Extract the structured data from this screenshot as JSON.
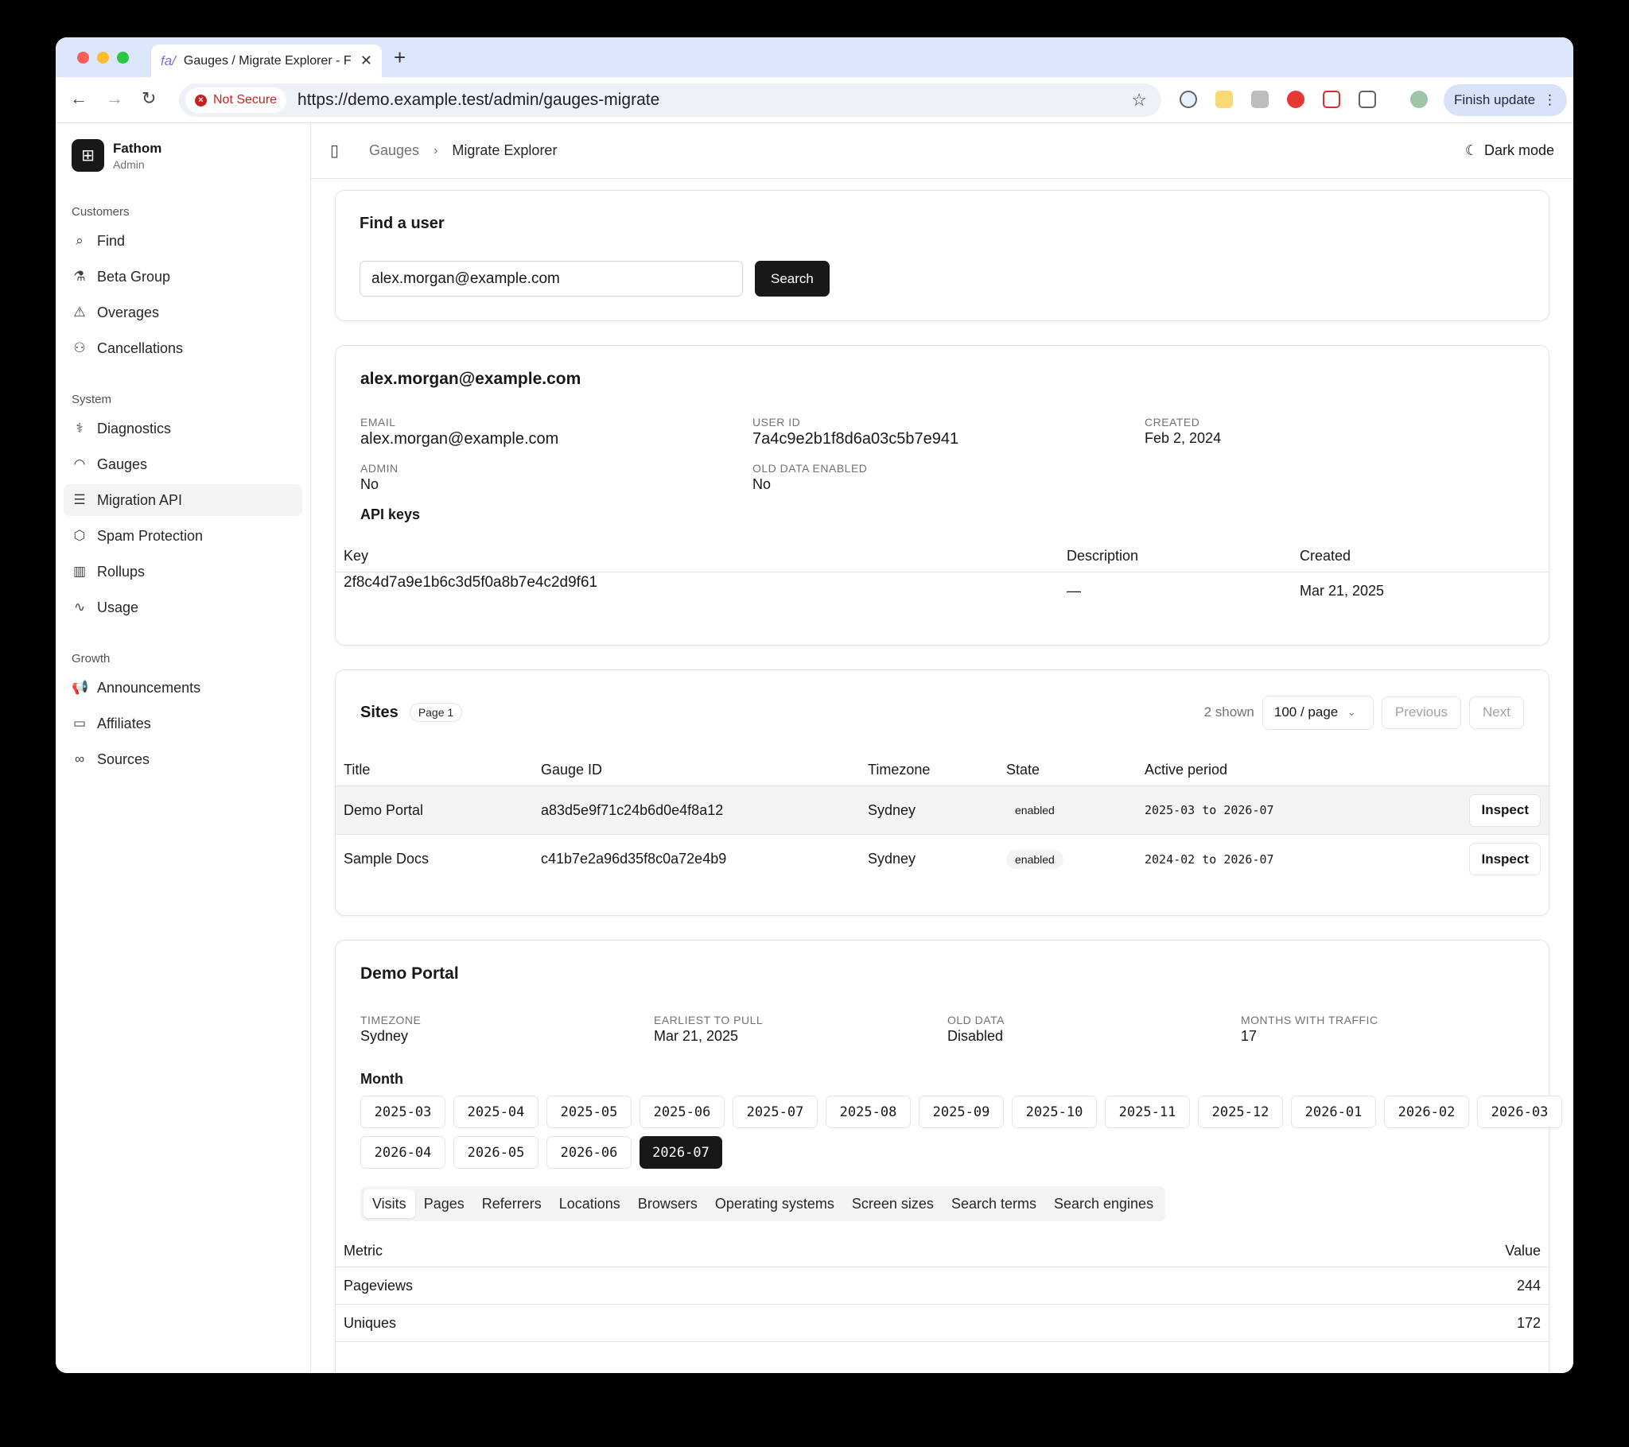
{
  "browser": {
    "tab_title": "Gauges / Migrate Explorer - F",
    "tab_favicon": "fa/",
    "security_label": "Not Secure",
    "url": "https://demo.example.test/admin/gauges-migrate",
    "finish_update": "Finish update"
  },
  "brand": {
    "name": "Fathom",
    "subtitle": "Admin"
  },
  "sidebar": {
    "groups": [
      {
        "label": "Customers",
        "items": [
          {
            "label": "Find",
            "icon": "search-icon"
          },
          {
            "label": "Beta Group",
            "icon": "flask-icon"
          },
          {
            "label": "Overages",
            "icon": "warning-icon"
          },
          {
            "label": "Cancellations",
            "icon": "user-minus-icon"
          }
        ]
      },
      {
        "label": "System",
        "items": [
          {
            "label": "Diagnostics",
            "icon": "stethoscope-icon"
          },
          {
            "label": "Gauges",
            "icon": "gauge-icon"
          },
          {
            "label": "Migration API",
            "icon": "database-icon",
            "active": true
          },
          {
            "label": "Spam Protection",
            "icon": "shield-icon"
          },
          {
            "label": "Rollups",
            "icon": "bar-chart-icon"
          },
          {
            "label": "Usage",
            "icon": "activity-icon"
          }
        ]
      },
      {
        "label": "Growth",
        "items": [
          {
            "label": "Announcements",
            "icon": "megaphone-icon"
          },
          {
            "label": "Affiliates",
            "icon": "banknote-icon"
          },
          {
            "label": "Sources",
            "icon": "link-icon"
          }
        ]
      }
    ]
  },
  "topbar": {
    "crumb_parent": "Gauges",
    "crumb_current": "Migrate Explorer",
    "dark_mode": "Dark mode"
  },
  "find": {
    "title": "Find a user",
    "input_value": "alex.morgan@example.com",
    "search_button": "Search"
  },
  "user": {
    "heading": "alex.morgan@example.com",
    "email_label": "EMAIL",
    "email": "alex.morgan@example.com",
    "user_id_label": "USER ID",
    "user_id": "7a4c9e2b1f8d6a03c5b7e941",
    "created_label": "CREATED",
    "created": "Feb 2, 2024",
    "admin_label": "ADMIN",
    "admin": "No",
    "old_data_label": "OLD DATA ENABLED",
    "old_data": "No",
    "api_keys_title": "API keys",
    "keys_columns": [
      "Key",
      "Description",
      "Created"
    ],
    "keys": [
      {
        "key": "2f8c4d7a9e1b6c3d5f0a8b7e4c2d9f61",
        "description": "—",
        "created": "Mar 21, 2025"
      }
    ]
  },
  "sites": {
    "title": "Sites",
    "page_badge": "Page 1",
    "shown": "2 shown",
    "per_page": "100 / page",
    "previous": "Previous",
    "next": "Next",
    "columns": [
      "Title",
      "Gauge ID",
      "Timezone",
      "State",
      "Active period"
    ],
    "rows": [
      {
        "title": "Demo Portal",
        "gauge_id": "a83d5e9f71c24b6d0e4f8a12",
        "timezone": "Sydney",
        "state": "enabled",
        "period": "2025-03 to 2026-07",
        "action": "Inspect"
      },
      {
        "title": "Sample Docs",
        "gauge_id": "c41b7e2a96d35f8c0a72e4b9",
        "timezone": "Sydney",
        "state": "enabled",
        "period": "2024-02 to 2026-07",
        "action": "Inspect"
      }
    ]
  },
  "detail": {
    "title": "Demo Portal",
    "timezone_label": "TIMEZONE",
    "timezone": "Sydney",
    "earliest_label": "EARLIEST TO PULL",
    "earliest": "Mar 21, 2025",
    "old_data_label": "OLD DATA",
    "old_data": "Disabled",
    "months_label": "MONTHS WITH TRAFFIC",
    "months_count": "17",
    "month_title": "Month",
    "months": [
      "2025-03",
      "2025-04",
      "2025-05",
      "2025-06",
      "2025-07",
      "2025-08",
      "2025-09",
      "2025-10",
      "2025-11",
      "2025-12",
      "2026-01",
      "2026-02",
      "2026-03",
      "2026-04",
      "2026-05",
      "2026-06",
      "2026-07"
    ],
    "selected_month": "2026-07",
    "tabs": [
      "Visits",
      "Pages",
      "Referrers",
      "Locations",
      "Browsers",
      "Operating systems",
      "Screen sizes",
      "Search terms",
      "Search engines"
    ],
    "selected_tab": "Visits",
    "metric_col": "Metric",
    "value_col": "Value",
    "metrics": [
      {
        "metric": "Pageviews",
        "value": "244"
      },
      {
        "metric": "Uniques",
        "value": "172"
      }
    ]
  }
}
